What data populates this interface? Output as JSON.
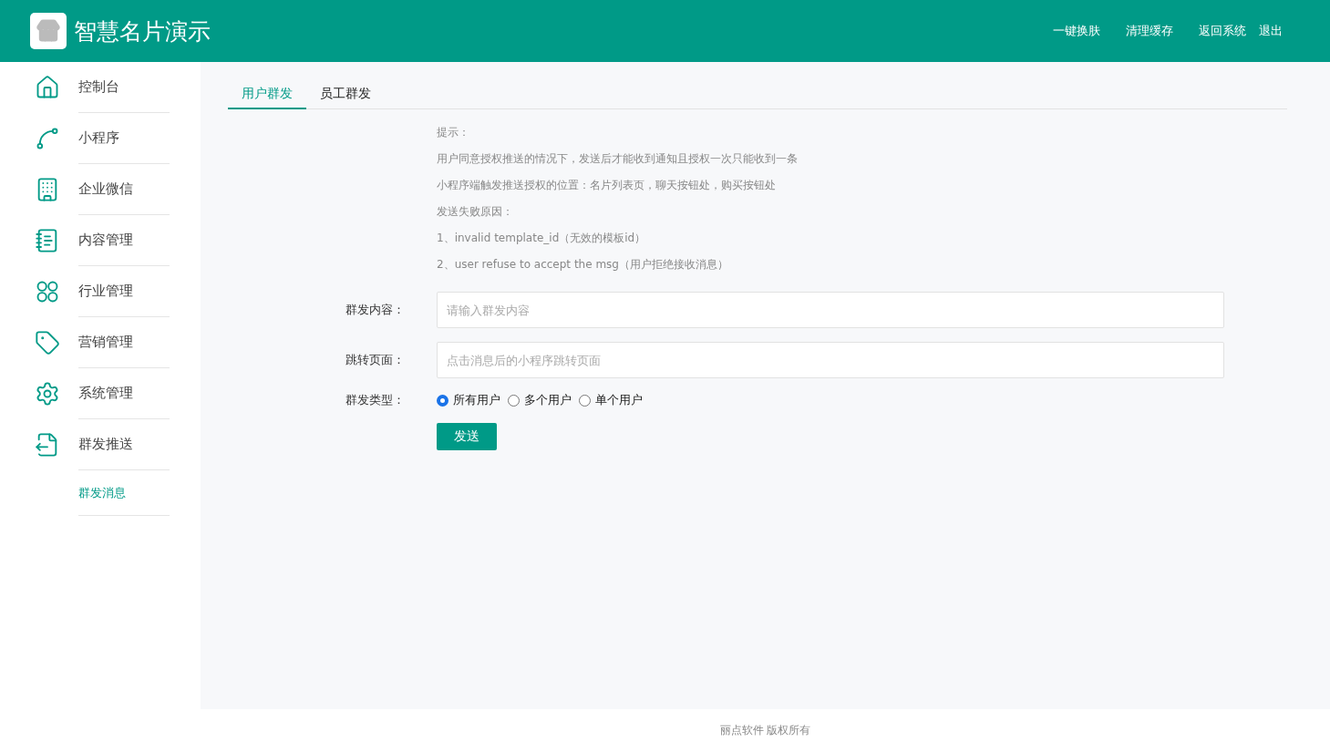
{
  "header": {
    "title": "智慧名片演示",
    "links": [
      "一键换肤",
      "清理缓存",
      "返回系统",
      "退出"
    ]
  },
  "sidebar": {
    "items": [
      {
        "label": "控制台"
      },
      {
        "label": "小程序"
      },
      {
        "label": "企业微信"
      },
      {
        "label": "内容管理"
      },
      {
        "label": "行业管理"
      },
      {
        "label": "营销管理"
      },
      {
        "label": "系统管理"
      },
      {
        "label": "群发推送",
        "children": [
          {
            "label": "群发消息",
            "selected": true
          }
        ]
      }
    ]
  },
  "tabs": [
    {
      "label": "用户群发",
      "selected": true
    },
    {
      "label": "员工群发",
      "selected": false
    }
  ],
  "hints": [
    "提示：",
    "用户同意授权推送的情况下，发送后才能收到通知且授权一次只能收到一条",
    "小程序端触发推送授权的位置：名片列表页，聊天按钮处，购买按钮处",
    "发送失败原因：",
    "1、invalid template_id（无效的模板id）",
    "2、user refuse to accept the msg（用户拒绝接收消息）"
  ],
  "form": {
    "fields": [
      {
        "label": "群发内容：",
        "placeholder": "请输入群发内容"
      },
      {
        "label": "跳转页面：",
        "placeholder": "点击消息后的小程序跳转页面"
      }
    ],
    "type_label": "群发类型：",
    "options": [
      {
        "label": "所有用户",
        "selected": true
      },
      {
        "label": "多个用户",
        "selected": false
      },
      {
        "label": "单个用户",
        "selected": false
      }
    ],
    "submit": "发送"
  },
  "footer": "丽点软件 版权所有"
}
